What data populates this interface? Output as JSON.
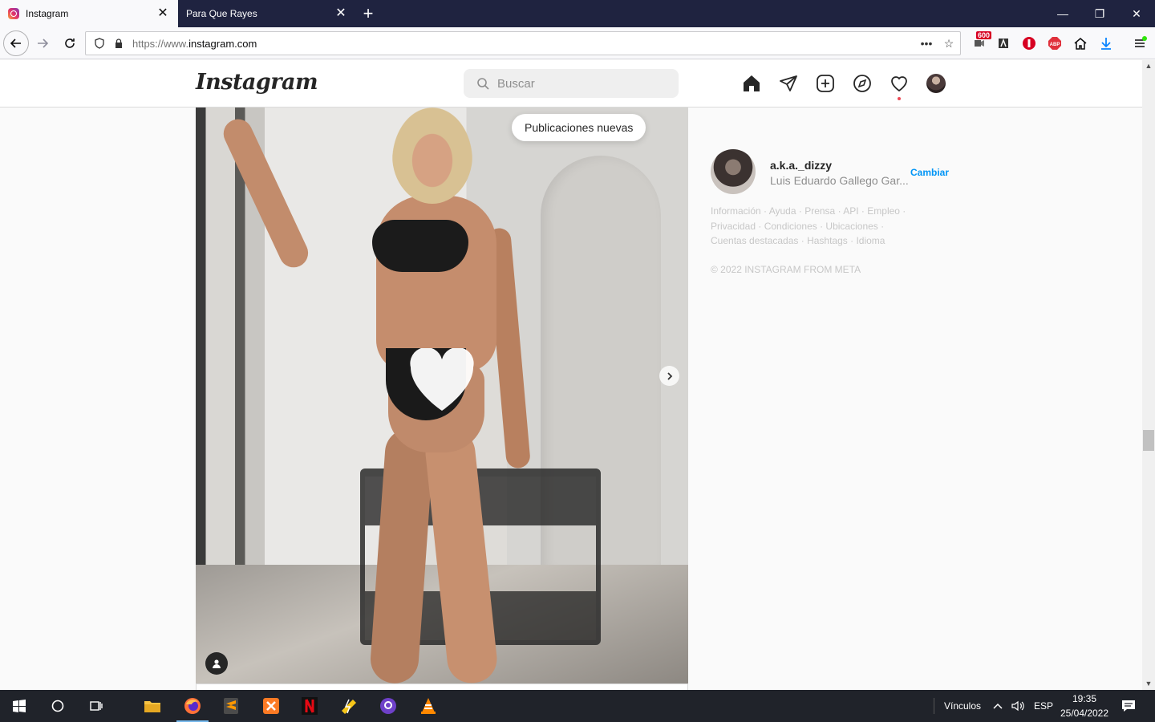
{
  "browser": {
    "tabs": [
      {
        "title": "Instagram",
        "active": true
      },
      {
        "title": "Para Que Rayes",
        "active": false
      }
    ],
    "url_scheme": "https://www.",
    "url_host": "instagram.com",
    "badge_count": "600",
    "abp_label": "ABP"
  },
  "instagram": {
    "logo": "Instagram",
    "search_placeholder": "Buscar",
    "new_posts_label": "Publicaciones nuevas",
    "nav_icons": [
      "home-icon",
      "direct-icon",
      "new-post-icon",
      "explore-icon",
      "activity-icon",
      "profile-avatar"
    ]
  },
  "sidebar": {
    "username": "a.k.a._dizzy",
    "full_name": "Luis Eduardo Gallego Gar...",
    "switch_label": "Cambiar",
    "footer_links": [
      "Información",
      "Ayuda",
      "Prensa",
      "API",
      "Empleo",
      "Privacidad",
      "Condiciones",
      "Ubicaciones",
      "Cuentas destacadas",
      "Hashtags",
      "Idioma"
    ],
    "copyright": "© 2022 INSTAGRAM FROM META"
  },
  "taskbar": {
    "links_label": "Vínculos",
    "language": "ESP",
    "time": "19:35",
    "date": "25/04/2022"
  },
  "colors": {
    "tabbar": "#1f2340",
    "link_blue": "#0095f6",
    "notification_red": "#ed4956"
  }
}
